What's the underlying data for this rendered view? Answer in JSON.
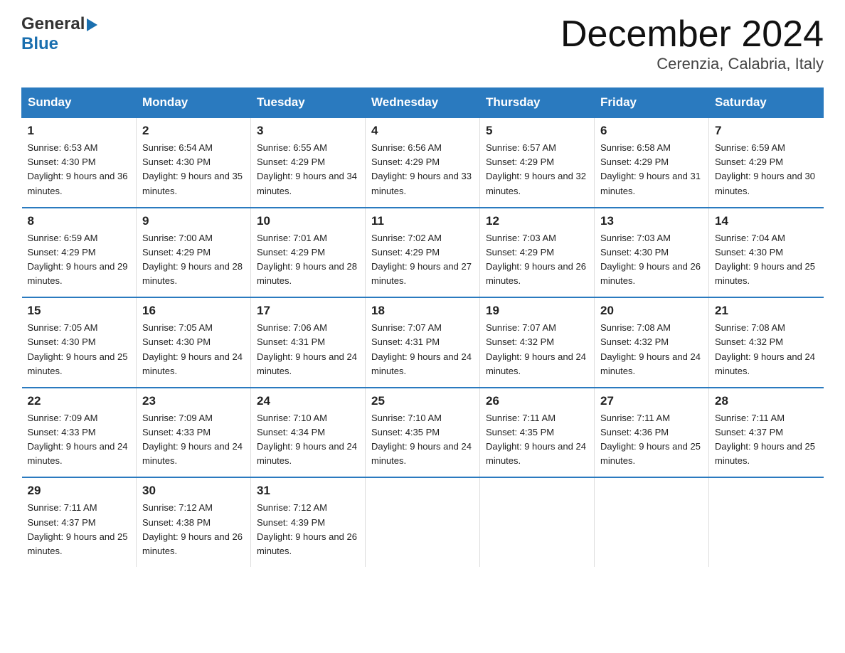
{
  "header": {
    "logo": {
      "line1": "General",
      "arrow": "▶",
      "line2": "Blue"
    },
    "title": "December 2024",
    "subtitle": "Cerenzia, Calabria, Italy"
  },
  "weekdays": [
    "Sunday",
    "Monday",
    "Tuesday",
    "Wednesday",
    "Thursday",
    "Friday",
    "Saturday"
  ],
  "weeks": [
    [
      {
        "day": "1",
        "sunrise": "6:53 AM",
        "sunset": "4:30 PM",
        "daylight": "9 hours and 36 minutes."
      },
      {
        "day": "2",
        "sunrise": "6:54 AM",
        "sunset": "4:30 PM",
        "daylight": "9 hours and 35 minutes."
      },
      {
        "day": "3",
        "sunrise": "6:55 AM",
        "sunset": "4:29 PM",
        "daylight": "9 hours and 34 minutes."
      },
      {
        "day": "4",
        "sunrise": "6:56 AM",
        "sunset": "4:29 PM",
        "daylight": "9 hours and 33 minutes."
      },
      {
        "day": "5",
        "sunrise": "6:57 AM",
        "sunset": "4:29 PM",
        "daylight": "9 hours and 32 minutes."
      },
      {
        "day": "6",
        "sunrise": "6:58 AM",
        "sunset": "4:29 PM",
        "daylight": "9 hours and 31 minutes."
      },
      {
        "day": "7",
        "sunrise": "6:59 AM",
        "sunset": "4:29 PM",
        "daylight": "9 hours and 30 minutes."
      }
    ],
    [
      {
        "day": "8",
        "sunrise": "6:59 AM",
        "sunset": "4:29 PM",
        "daylight": "9 hours and 29 minutes."
      },
      {
        "day": "9",
        "sunrise": "7:00 AM",
        "sunset": "4:29 PM",
        "daylight": "9 hours and 28 minutes."
      },
      {
        "day": "10",
        "sunrise": "7:01 AM",
        "sunset": "4:29 PM",
        "daylight": "9 hours and 28 minutes."
      },
      {
        "day": "11",
        "sunrise": "7:02 AM",
        "sunset": "4:29 PM",
        "daylight": "9 hours and 27 minutes."
      },
      {
        "day": "12",
        "sunrise": "7:03 AM",
        "sunset": "4:29 PM",
        "daylight": "9 hours and 26 minutes."
      },
      {
        "day": "13",
        "sunrise": "7:03 AM",
        "sunset": "4:30 PM",
        "daylight": "9 hours and 26 minutes."
      },
      {
        "day": "14",
        "sunrise": "7:04 AM",
        "sunset": "4:30 PM",
        "daylight": "9 hours and 25 minutes."
      }
    ],
    [
      {
        "day": "15",
        "sunrise": "7:05 AM",
        "sunset": "4:30 PM",
        "daylight": "9 hours and 25 minutes."
      },
      {
        "day": "16",
        "sunrise": "7:05 AM",
        "sunset": "4:30 PM",
        "daylight": "9 hours and 24 minutes."
      },
      {
        "day": "17",
        "sunrise": "7:06 AM",
        "sunset": "4:31 PM",
        "daylight": "9 hours and 24 minutes."
      },
      {
        "day": "18",
        "sunrise": "7:07 AM",
        "sunset": "4:31 PM",
        "daylight": "9 hours and 24 minutes."
      },
      {
        "day": "19",
        "sunrise": "7:07 AM",
        "sunset": "4:32 PM",
        "daylight": "9 hours and 24 minutes."
      },
      {
        "day": "20",
        "sunrise": "7:08 AM",
        "sunset": "4:32 PM",
        "daylight": "9 hours and 24 minutes."
      },
      {
        "day": "21",
        "sunrise": "7:08 AM",
        "sunset": "4:32 PM",
        "daylight": "9 hours and 24 minutes."
      }
    ],
    [
      {
        "day": "22",
        "sunrise": "7:09 AM",
        "sunset": "4:33 PM",
        "daylight": "9 hours and 24 minutes."
      },
      {
        "day": "23",
        "sunrise": "7:09 AM",
        "sunset": "4:33 PM",
        "daylight": "9 hours and 24 minutes."
      },
      {
        "day": "24",
        "sunrise": "7:10 AM",
        "sunset": "4:34 PM",
        "daylight": "9 hours and 24 minutes."
      },
      {
        "day": "25",
        "sunrise": "7:10 AM",
        "sunset": "4:35 PM",
        "daylight": "9 hours and 24 minutes."
      },
      {
        "day": "26",
        "sunrise": "7:11 AM",
        "sunset": "4:35 PM",
        "daylight": "9 hours and 24 minutes."
      },
      {
        "day": "27",
        "sunrise": "7:11 AM",
        "sunset": "4:36 PM",
        "daylight": "9 hours and 25 minutes."
      },
      {
        "day": "28",
        "sunrise": "7:11 AM",
        "sunset": "4:37 PM",
        "daylight": "9 hours and 25 minutes."
      }
    ],
    [
      {
        "day": "29",
        "sunrise": "7:11 AM",
        "sunset": "4:37 PM",
        "daylight": "9 hours and 25 minutes."
      },
      {
        "day": "30",
        "sunrise": "7:12 AM",
        "sunset": "4:38 PM",
        "daylight": "9 hours and 26 minutes."
      },
      {
        "day": "31",
        "sunrise": "7:12 AM",
        "sunset": "4:39 PM",
        "daylight": "9 hours and 26 minutes."
      },
      null,
      null,
      null,
      null
    ]
  ]
}
